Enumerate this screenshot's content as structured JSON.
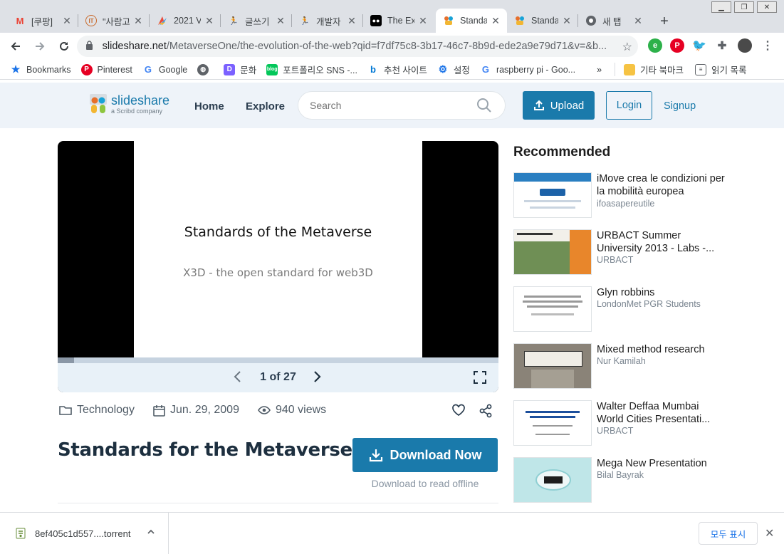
{
  "browser": {
    "tabs": [
      {
        "title": "[쿠팡]",
        "icon": "gmail-icon",
        "active": false
      },
      {
        "title": "\"사람고",
        "icon": "it-icon",
        "active": false
      },
      {
        "title": "2021 V",
        "icon": "colorful-leaf-icon",
        "active": false
      },
      {
        "title": "글쓰기",
        "icon": "runner-icon",
        "active": false
      },
      {
        "title": "개발자",
        "icon": "runner-icon",
        "active": false
      },
      {
        "title": "The Ex",
        "icon": "medium-icon",
        "active": false
      },
      {
        "title": "Standa",
        "icon": "slideshare-icon",
        "active": true
      },
      {
        "title": "Standa",
        "icon": "slideshare-icon",
        "active": false
      },
      {
        "title": "새 탭",
        "icon": "chrome-icon",
        "active": false
      }
    ],
    "url_host": "slideshare.net",
    "url_path": "/MetaverseOne/the-evolution-of-the-web?qid=f7df75c8-3b17-46c7-8b9d-ede2a9e79d71&v=&b...",
    "bookmarks": [
      {
        "label": "Bookmarks",
        "icon": "star-icon"
      },
      {
        "label": "Pinterest",
        "icon": "pinterest-icon"
      },
      {
        "label": "Google",
        "icon": "google-icon"
      },
      {
        "label": "",
        "icon": "globe-icon"
      },
      {
        "label": "문화",
        "icon": "d-icon"
      },
      {
        "label": "포트폴리오 SNS -...",
        "icon": "blog-icon"
      },
      {
        "label": "추천 사이트",
        "icon": "bing-icon"
      },
      {
        "label": "설정",
        "icon": "gear-icon"
      },
      {
        "label": "raspberry pi - Goo...",
        "icon": "google-icon"
      }
    ],
    "bookmarks_more": "»",
    "other_bookmarks": "기타 북마크",
    "reading_list": "읽기 목록"
  },
  "header": {
    "logo_word": "slideshare",
    "logo_sub": "a Scribd company",
    "nav": [
      "Home",
      "Explore"
    ],
    "search_placeholder": "Search",
    "upload": "Upload",
    "login": "Login",
    "signup": "Signup"
  },
  "slide": {
    "title": "Standards of the Metaverse",
    "subtitle": "X3D - the open standard for web3D",
    "current_page": 1,
    "total_pages": 27,
    "pager_text": "1 of 27"
  },
  "meta": {
    "category": "Technology",
    "date": "Jun. 29, 2009",
    "views": "940 views"
  },
  "document": {
    "title": "Standards for the Metaverse",
    "download_label": "Download Now",
    "download_hint": "Download to read offline"
  },
  "recommended": {
    "heading": "Recommended",
    "items": [
      {
        "title": "iMove crea le condizioni per la mobilità europea",
        "author": "ifoasapereutile"
      },
      {
        "title": "URBACT Summer University 2013 - Labs -...",
        "author": "URBACT"
      },
      {
        "title": "Glyn robbins",
        "author": "LondonMet PGR Students"
      },
      {
        "title": "Mixed method research",
        "author": "Nur Kamilah"
      },
      {
        "title": "Walter Deffaa Mumbai World Cities Presentati...",
        "author": "URBACT"
      },
      {
        "title": "Mega New Presentation",
        "author": "Bilal Bayrak"
      }
    ]
  },
  "download_shelf": {
    "file": "8ef405c1d557....torrent",
    "show_all": "모두 표시"
  },
  "colors": {
    "brand": "#1a7aab",
    "header_bg": "#eef3f9",
    "controls_bg": "#e8f1f8"
  }
}
